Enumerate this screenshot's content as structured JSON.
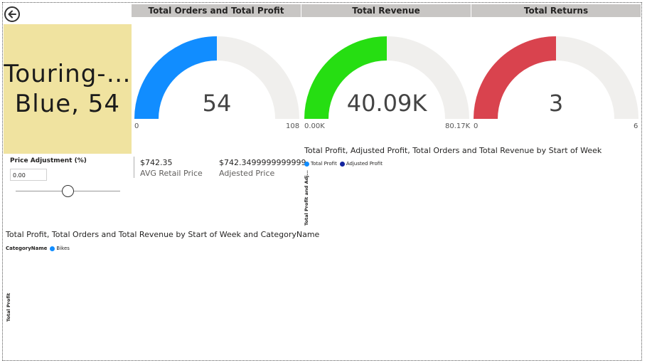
{
  "headers": {
    "orders_profit": "Total Orders and Total Profit",
    "revenue": "Total Revenue",
    "returns": "Total Returns"
  },
  "product_card": {
    "line1": "Touring-…",
    "line2": "Blue, 54"
  },
  "gauges": {
    "orders": {
      "value": 54,
      "value_text": "54",
      "min": "0",
      "max": "108",
      "fraction": 0.5,
      "color": "#118dff"
    },
    "revenue": {
      "value_text": "40.09K",
      "min": "0.00K",
      "max": "80.17K",
      "fraction": 0.5,
      "color": "#26de12"
    },
    "returns": {
      "value": 3,
      "value_text": "3",
      "min": "0",
      "max": "6",
      "fraction": 0.5,
      "color": "#d9434e"
    },
    "track_color": "#f0efed"
  },
  "slicer": {
    "title": "Price Adjustment (%)",
    "value": "0.00",
    "slider_fraction": 0.5
  },
  "kpis": {
    "avg_retail_value": "$742.35",
    "avg_retail_label": "AVG Retail Price",
    "adjusted_value": "$742.3499999999999",
    "adjusted_label": "Adjested Price"
  },
  "chart_week": {
    "title": "Total Profit, Adjusted Profit, Total Orders and Total Revenue by Start of Week",
    "legend": [
      {
        "label": "Total Profit",
        "color": "#118dff"
      },
      {
        "label": "Adjusted Profit",
        "color": "#12239e"
      }
    ],
    "y_axis_label": "Total Profit and Adj..."
  },
  "chart_category": {
    "title": "Total Profit, Total Orders and Total Revenue by Start of Week and CategoryName",
    "legend_title": "CategoryName",
    "legend": [
      {
        "label": "Bikes",
        "color": "#118dff"
      }
    ],
    "y_axis_label": "Total Profit"
  }
}
